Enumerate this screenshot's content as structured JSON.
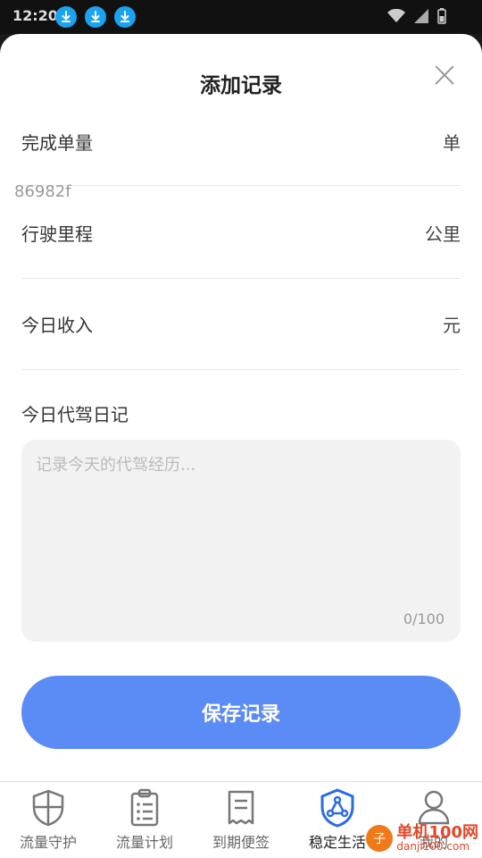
{
  "status_bar": {
    "time": "12:20",
    "icons": [
      "download-icon",
      "download-icon",
      "download-icon",
      "wifi-icon",
      "signal-icon",
      "battery-icon"
    ]
  },
  "sheet": {
    "title": "添加记录",
    "rows": [
      {
        "label": "完成单量",
        "unit": "单",
        "value": "86982f",
        "placeholder": ""
      },
      {
        "label": "行驶里程",
        "unit": "公里",
        "value": "",
        "placeholder": ""
      },
      {
        "label": "今日收入",
        "unit": "元",
        "value": "",
        "placeholder": ""
      }
    ],
    "diary": {
      "label": "今日代驾日记",
      "placeholder": "记录今天的代驾经历...",
      "counter": "0/100"
    },
    "save_label": "保存记录"
  },
  "bottom_nav": {
    "items": [
      {
        "label": "流量守护",
        "icon": "shield-icon"
      },
      {
        "label": "流量计划",
        "icon": "clipboard-icon"
      },
      {
        "label": "到期便签",
        "icon": "note-icon"
      },
      {
        "label": "稳定生活",
        "icon": "shield-network-icon",
        "active": true
      },
      {
        "label": "我的",
        "icon": "user-icon"
      }
    ]
  },
  "watermark": {
    "badge": "子",
    "line1": "单机100网",
    "line2": "danji100.com"
  },
  "colors": {
    "accent": "#5b8bf5",
    "active_nav": "#2b6be6",
    "download_badge": "#1aa3f0"
  }
}
